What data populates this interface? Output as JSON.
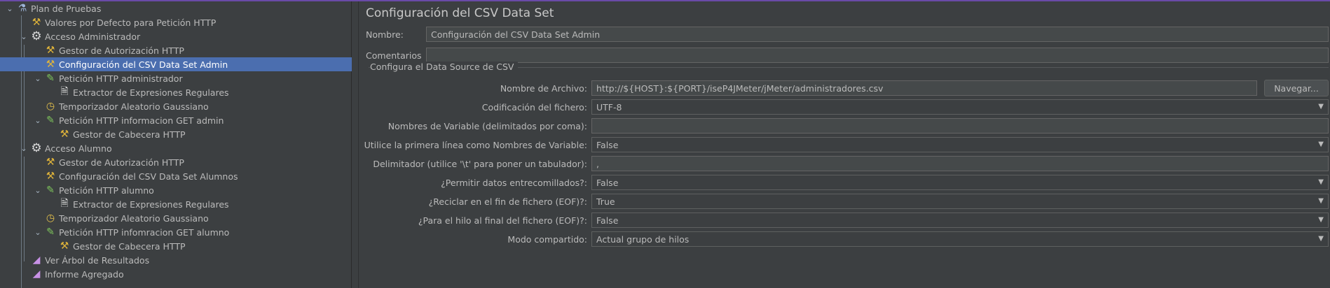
{
  "tree": {
    "items": [
      {
        "label": "Plan de Pruebas",
        "icon": "flask-icon",
        "glyph": "⚗",
        "twisty": "⌄"
      },
      {
        "label": "Valores por Defecto para Petición HTTP",
        "icon": "tools-icon",
        "glyph": "⚒",
        "twisty": ""
      },
      {
        "label": "Acceso Administrador",
        "icon": "gear-icon",
        "glyph": "⚙",
        "twisty": "⌄"
      },
      {
        "label": "Gestor de Autorización HTTP",
        "icon": "tools-icon",
        "glyph": "⚒",
        "twisty": ""
      },
      {
        "label": "Configuración del CSV Data Set Admin",
        "icon": "tools-icon",
        "glyph": "⚒",
        "twisty": "",
        "selected": true
      },
      {
        "label": "Petición HTTP administrador",
        "icon": "pen-icon",
        "glyph": "✎",
        "twisty": "⌄"
      },
      {
        "label": "Extractor de Expresiones Regulares",
        "icon": "document-icon",
        "glyph": "🗎",
        "twisty": ""
      },
      {
        "label": "Temporizador Aleatorio Gaussiano",
        "icon": "timer-icon",
        "glyph": "◷",
        "twisty": ""
      },
      {
        "label": "Petición HTTP informacion GET admin",
        "icon": "pen-icon",
        "glyph": "✎",
        "twisty": "⌄"
      },
      {
        "label": "Gestor de Cabecera HTTP",
        "icon": "tools-icon",
        "glyph": "⚒",
        "twisty": ""
      },
      {
        "label": "Acceso Alumno",
        "icon": "gear-icon",
        "glyph": "⚙",
        "twisty": "⌄"
      },
      {
        "label": "Gestor de Autorización HTTP",
        "icon": "tools-icon",
        "glyph": "⚒",
        "twisty": ""
      },
      {
        "label": "Configuración del CSV Data Set Alumnos",
        "icon": "tools-icon",
        "glyph": "⚒",
        "twisty": ""
      },
      {
        "label": "Petición HTTP alumno",
        "icon": "pen-icon",
        "glyph": "✎",
        "twisty": "⌄"
      },
      {
        "label": "Extractor de Expresiones Regulares",
        "icon": "document-icon",
        "glyph": "🗎",
        "twisty": ""
      },
      {
        "label": "Temporizador Aleatorio Gaussiano",
        "icon": "timer-icon",
        "glyph": "◷",
        "twisty": ""
      },
      {
        "label": "Petición HTTP infomracion GET alumno",
        "icon": "pen-icon",
        "glyph": "✎",
        "twisty": "⌄"
      },
      {
        "label": "Gestor de Cabecera HTTP",
        "icon": "tools-icon",
        "glyph": "⚒",
        "twisty": ""
      },
      {
        "label": "Ver Árbol de Resultados",
        "icon": "graph-icon",
        "glyph": "◢",
        "twisty": ""
      },
      {
        "label": "Informe Agregado",
        "icon": "graph-icon",
        "glyph": "◢",
        "twisty": ""
      }
    ]
  },
  "panel": {
    "title": "Configuración del CSV Data Set",
    "name_label": "Nombre:",
    "name_value": "Configuración del CSV Data Set Admin",
    "comments_label": "Comentarios",
    "comments_value": "",
    "group_title": "Configura el Data Source de CSV",
    "filename_label": "Nombre de Archivo:",
    "filename_value": "http://${HOST}:${PORT}/iseP4JMeter/jMeter/administradores.csv",
    "browse_label": "Navegar...",
    "encoding_label": "Codificación del fichero:",
    "encoding_value": "UTF-8",
    "varnames_label": "Nombres de Variable (delimitados por coma):",
    "varnames_value": "",
    "firstline_label": "Utilice la primera línea como Nombres de Variable:",
    "firstline_value": "False",
    "delimiter_label": "Delimitador (utilice '\\t' para poner un tabulador):",
    "delimiter_value": ",",
    "quoted_label": "¿Permitir datos entrecomillados?:",
    "quoted_value": "False",
    "recycle_label": "¿Reciclar en el fin de fichero (EOF)?:",
    "recycle_value": "True",
    "stop_label": "¿Para el hilo al final del fichero (EOF)?:",
    "stop_value": "False",
    "share_label": "Modo compartido:",
    "share_value": "Actual grupo de hilos"
  },
  "colors": {
    "background": "#3c3f41",
    "selection": "#4b6eaf",
    "field": "#45494a",
    "accent": "#6a4aa8"
  }
}
